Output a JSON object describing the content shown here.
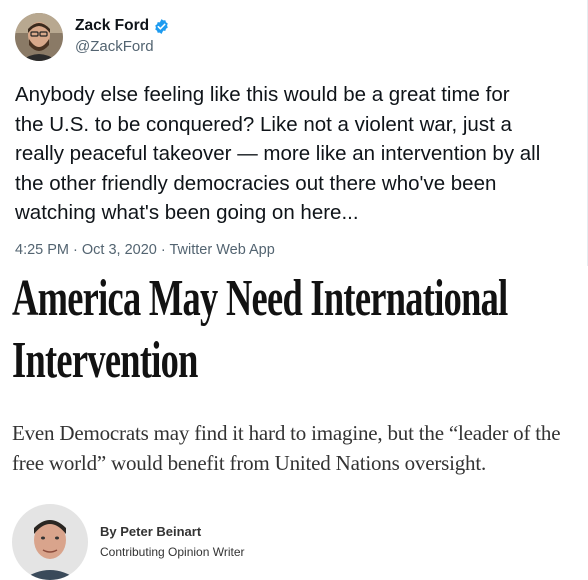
{
  "tweet": {
    "author_name": "Zack Ford",
    "handle": "@ZackFord",
    "text": "Anybody else feeling like this would be a great time for\nthe U.S. to be conquered? Like not a violent war, just a\nreally peaceful takeover — more like an intervention by all\nthe other friendly democracies out there who've been\nwatching what's been going on here...",
    "timestamp": "4:25 PM · Oct 3, 2020",
    "separator": " · ",
    "source_app": "Twitter Web App",
    "verified_color": "#1d9bf0"
  },
  "article": {
    "headline_line1": "America May Need International",
    "headline_line2": "Intervention",
    "dek": "Even Democrats may find it hard to imagine, but the “leader of the free world” would benefit from United Nations oversight.",
    "byline": "By Peter Beinart",
    "byline_role": "Contributing Opinion Writer"
  }
}
